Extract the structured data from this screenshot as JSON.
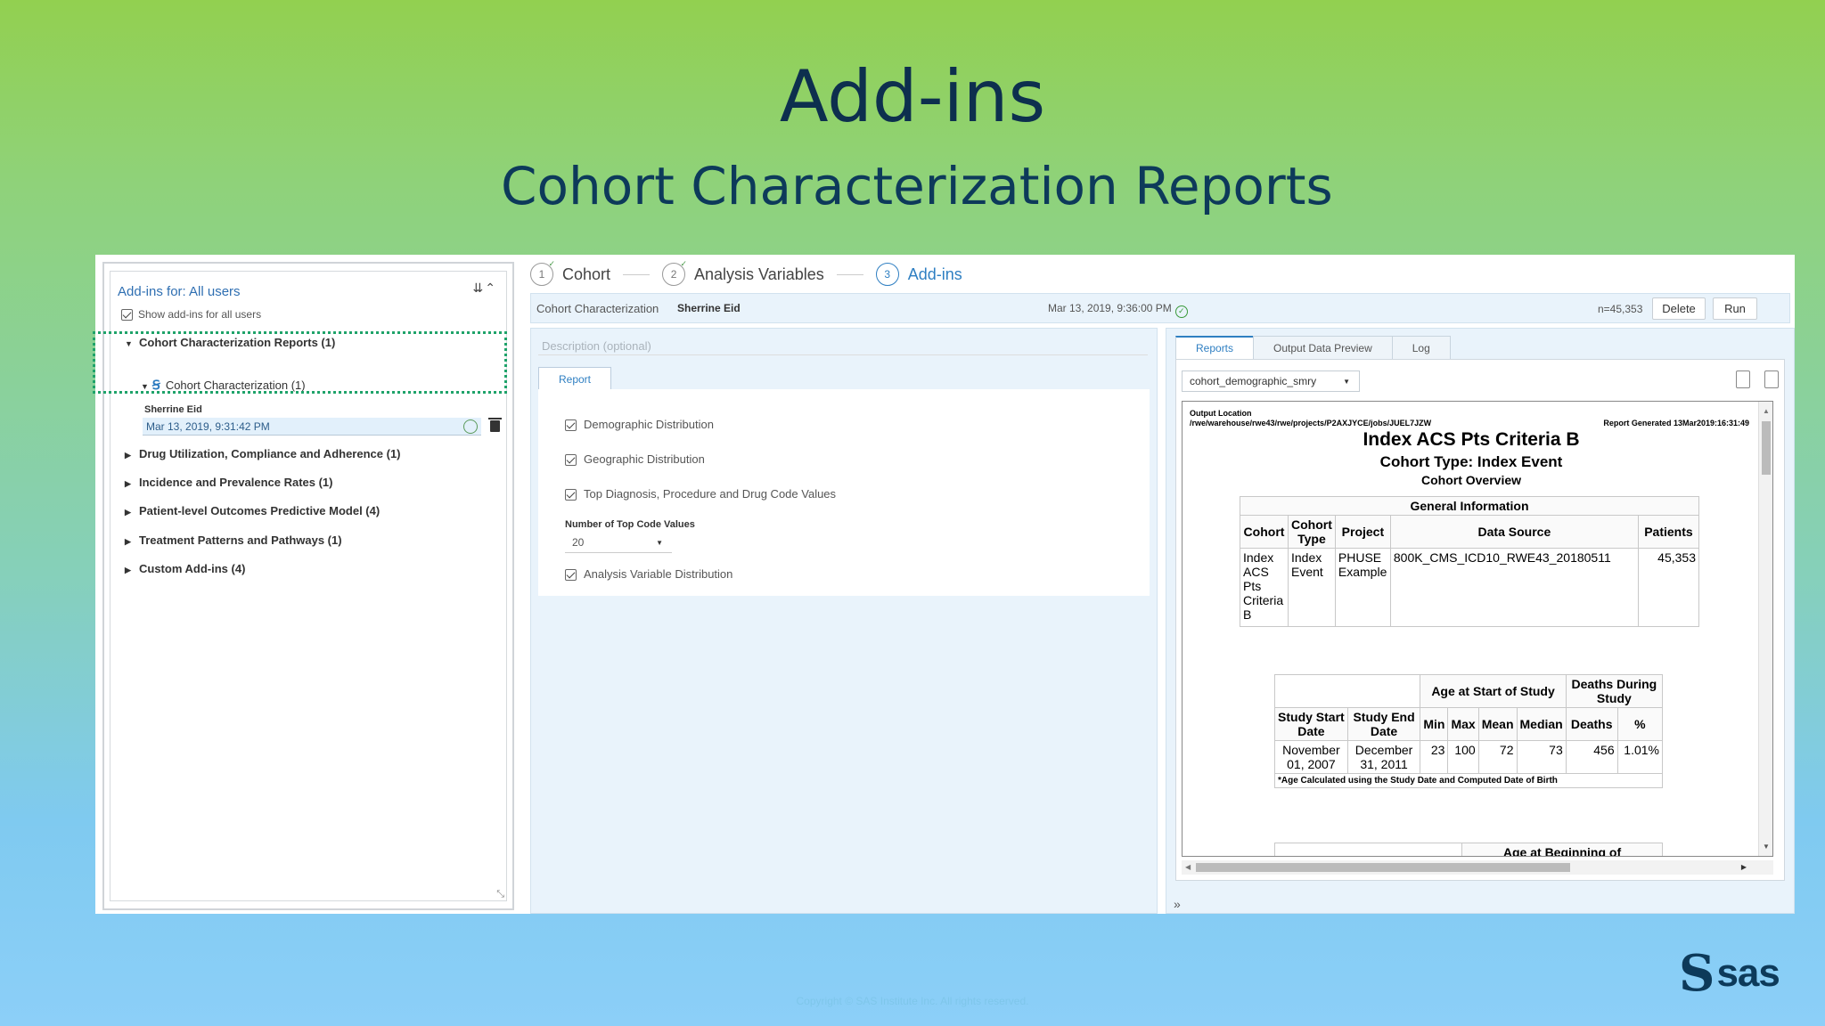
{
  "slide": {
    "title": "Add-ins",
    "subtitle": "Cohort Characterization Reports",
    "copyright": "Copyright © SAS Institute Inc. All rights reserved."
  },
  "left_panel": {
    "header": "Add-ins for: All users",
    "show_all": "Show add-ins for all users",
    "categories": [
      {
        "label": "Cohort Characterization Reports (1)",
        "expanded": true
      },
      {
        "label": "Drug Utilization, Compliance and Adherence (1)"
      },
      {
        "label": "Incidence and Prevalence Rates (1)"
      },
      {
        "label": "Patient-level Outcomes Predictive Model (4)"
      },
      {
        "label": "Treatment Patterns and Pathways (1)"
      },
      {
        "label": "Custom Add-ins (4)"
      }
    ],
    "sub_item": {
      "label": "Cohort Characterization (1)",
      "author": "Sherrine Eid",
      "date": "Mar 13, 2019, 9:31:42 PM"
    }
  },
  "wizard": {
    "steps": [
      {
        "num": "1",
        "label": "Cohort"
      },
      {
        "num": "2",
        "label": "Analysis Variables"
      },
      {
        "num": "3",
        "label": "Add-ins"
      }
    ]
  },
  "infobar": {
    "name": "Cohort Characterization",
    "user": "Sherrine Eid",
    "date": "Mar 13, 2019, 9:36:00 PM",
    "count": "n=45,353",
    "delete_label": "Delete",
    "run_label": "Run"
  },
  "middle": {
    "description_placeholder": "Description (optional)",
    "tab_report": "Report",
    "options": [
      "Demographic Distribution",
      "Geographic Distribution",
      "Top Diagnosis, Procedure and Drug Code Values"
    ],
    "top_codes_label": "Number of Top Code Values",
    "top_codes_value": "20",
    "analysis_option": "Analysis Variable Distribution"
  },
  "right": {
    "tabs": [
      "Reports",
      "Output Data Preview",
      "Log"
    ],
    "dataset": "cohort_demographic_smry",
    "output": {
      "location_label": "Output Location",
      "location": "/rwe/warehouse/rwe43/rwe/projects/P2AXJYCE/jobs/JUEL7JZW",
      "generated": "Report Generated 13Mar2019:16:31:49",
      "title": "Index ACS Pts Criteria B",
      "sub1": "Cohort Type: Index Event",
      "sub2": "Cohort Overview",
      "general": {
        "caption": "General Information",
        "headers": [
          "Cohort",
          "Cohort Type",
          "Project",
          "Data Source",
          "Patients"
        ],
        "row": [
          "Index ACS Pts Criteria B",
          "Index Event",
          "PHUSE Example",
          "800K_CMS_ICD10_RWE43_20180511",
          "45,353"
        ]
      },
      "study": {
        "group_age": "Age at Start of Study",
        "group_deaths": "Deaths During Study",
        "headers": [
          "Study Start Date",
          "Study End Date",
          "Min",
          "Max",
          "Mean",
          "Median",
          "Deaths",
          "%"
        ],
        "row": [
          "November 01, 2007",
          "December 31, 2011",
          "23",
          "100",
          "72",
          "73",
          "456",
          "1.01%"
        ],
        "footnote": "*Age Calculated using the Study Date and Computed Date of Birth"
      },
      "next_header": "Age at Beginning of"
    }
  },
  "logo": {
    "mark": "S",
    "word": "sas"
  }
}
